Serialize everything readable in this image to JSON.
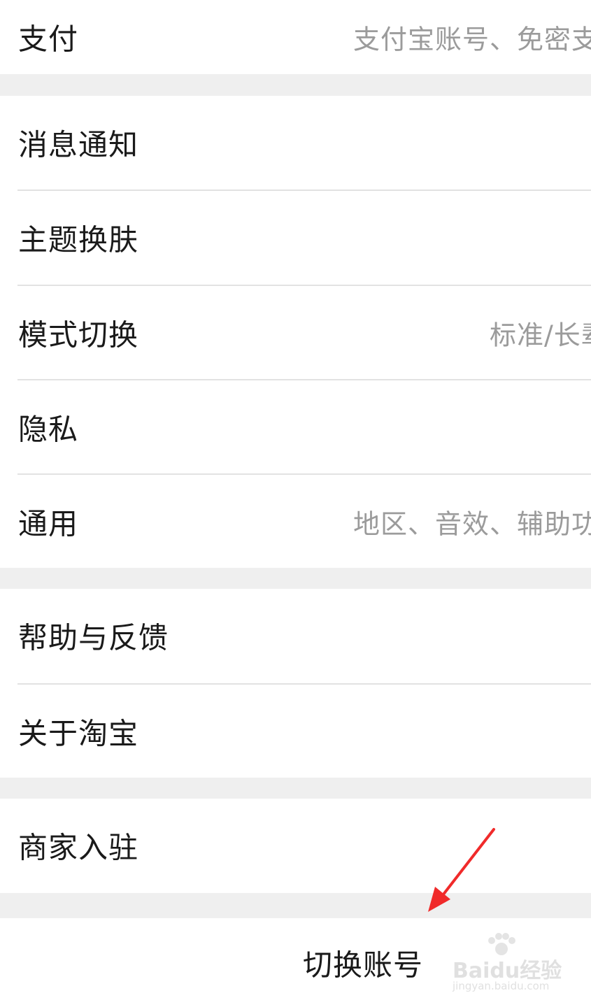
{
  "settings": {
    "pay": {
      "label": "支付",
      "detail": "支付宝账号、免密支付"
    },
    "notify": {
      "label": "消息通知"
    },
    "theme": {
      "label": "主题换肤"
    },
    "mode": {
      "label": "模式切换",
      "detail": "标准/长辈版"
    },
    "privacy": {
      "label": "隐私"
    },
    "general": {
      "label": "通用",
      "detail": "地区、音效、辅助功能"
    },
    "help": {
      "label": "帮助与反馈"
    },
    "about": {
      "label": "关于淘宝"
    },
    "merchant": {
      "label": "商家入驻"
    }
  },
  "switch_account": {
    "label": "切换账号"
  },
  "watermark": {
    "brand": "Baidu经验",
    "url": "jingyan.baidu.com"
  },
  "colors": {
    "accent_arrow": "#f02a2a"
  }
}
